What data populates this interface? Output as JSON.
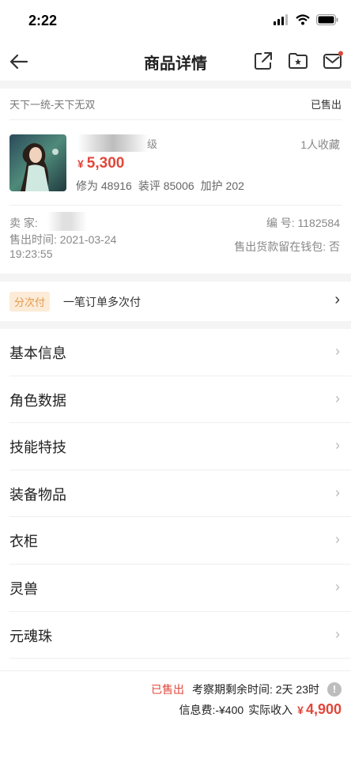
{
  "status_bar": {
    "time": "2:22"
  },
  "nav": {
    "title": "商品详情"
  },
  "store": {
    "name": "天下一统-天下无双",
    "status": "已售出"
  },
  "item": {
    "name_suffix": "级",
    "price_currency": "¥",
    "price": "5,300",
    "favorites": "1人收藏",
    "stats": [
      "修为 48916",
      "装评 85006",
      "加护 202"
    ]
  },
  "seller": {
    "label": "卖 家:",
    "serial": "编 号: 1182584",
    "sold_time": "售出时间: 2021-03-24 19:23:55",
    "wallet": "售出货款留在钱包: 否"
  },
  "pay": {
    "tag": "分次付",
    "text": "一笔订单多次付"
  },
  "menu": [
    {
      "label": "基本信息"
    },
    {
      "label": "角色数据"
    },
    {
      "label": "技能特技"
    },
    {
      "label": "装备物品"
    },
    {
      "label": "衣柜"
    },
    {
      "label": "灵兽"
    },
    {
      "label": "元魂珠"
    }
  ],
  "footer": {
    "sold": "已售出",
    "period": "考察期剩余时间: 2天 23时",
    "info_icon": "!",
    "fee": "信息费:-¥400",
    "income_label": "实际收入",
    "income_currency": "¥",
    "income_value": "4,900"
  },
  "colors": {
    "accent_red": "#e0473a",
    "tag_bg": "#fcebd6",
    "tag_text": "#e39a4e"
  }
}
